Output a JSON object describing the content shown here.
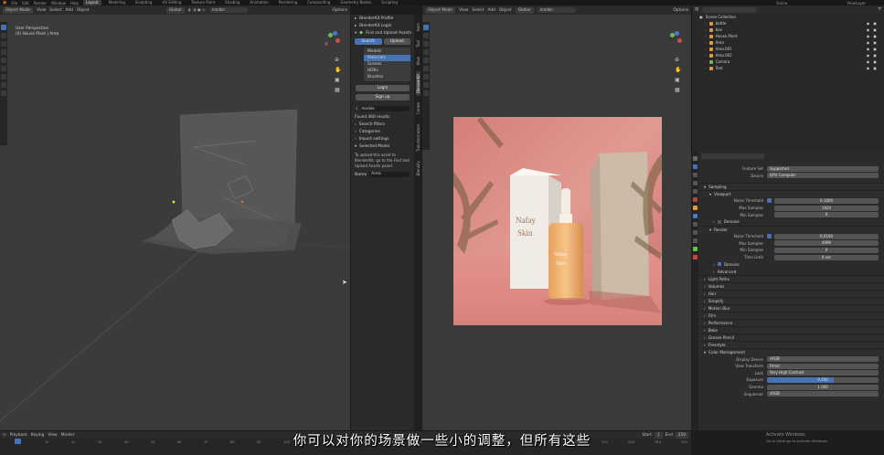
{
  "topbar": {
    "menus": [
      "File",
      "Edit",
      "Render",
      "Window",
      "Help"
    ],
    "workspaces": [
      "Layout",
      "Modeling",
      "Sculpting",
      "UV Editing",
      "Texture Paint",
      "Shading",
      "Animation",
      "Rendering",
      "Compositing",
      "Geometry Nodes",
      "Scripting"
    ],
    "active_workspace": "Layout",
    "scene": "Scene",
    "view_layer": "ViewLayer"
  },
  "viewport_left": {
    "mode": "Object Mode",
    "menus": [
      "View",
      "Select",
      "Add",
      "Object"
    ],
    "transform": "Global",
    "search": "marble",
    "options": "Options",
    "info_line1": "User Perspective",
    "info_line2": "(0) House Plant | Area",
    "subtitle_truncated": "(80"
  },
  "npanel": {
    "items": [
      "BlenderKit Profile",
      "BlenderKit Login",
      "Find and Upload Assets"
    ],
    "search_btn": "Search",
    "upload_btn": "Upload",
    "categories": [
      "Models",
      "Materials",
      "Scenes",
      "HDRs",
      "Brushes"
    ],
    "active_category": "Materials",
    "login_btn": "Login",
    "signup_btn": "Sign up",
    "search_value": "marble",
    "found_text": "Found 460 results",
    "search_filters": "Search filters",
    "categories_label": "Categories",
    "import_settings": "Import settings",
    "selected_model": "Selected Model",
    "upload_text1": "To upload this asset to",
    "upload_text2": "BlenderKit, go to the Find and",
    "upload_text3": "Upload Assets panel.",
    "name_label": "Name",
    "name_value": "Area",
    "vtabs": [
      "Item",
      "Tool",
      "View",
      "BlenderKit",
      "Create",
      "Transformation",
      "Blendify"
    ]
  },
  "viewport_right": {
    "mode": "Object Mode",
    "menus": [
      "View",
      "Select",
      "Add",
      "Object"
    ],
    "transform": "Global",
    "search": "marble",
    "options": "Options",
    "box_text1": "Nafay",
    "box_text2": "Skin",
    "bottle_text1": "Nafay",
    "bottle_text2": "Skin"
  },
  "outliner": {
    "title": "Scene Collection",
    "items": [
      {
        "name": "bottle",
        "color": "#d79a4a"
      },
      {
        "name": "box",
        "color": "#d79a4a"
      },
      {
        "name": "House Plant",
        "color": "#d79a4a"
      },
      {
        "name": "Area",
        "color": "#e0a03a"
      },
      {
        "name": "Area.001",
        "color": "#e0a03a"
      },
      {
        "name": "Area.002",
        "color": "#e0a03a"
      },
      {
        "name": "Camera",
        "color": "#6fb35a"
      },
      {
        "name": "Text",
        "color": "#d79a4a"
      }
    ]
  },
  "properties": {
    "feature_set_label": "Feature Set",
    "feature_set": "Supported",
    "device_label": "Device",
    "device": "GPU Compute",
    "sampling": "Sampling",
    "viewport": "Viewport",
    "noise_threshold_label": "Noise Threshold",
    "noise_threshold_vp": "0.1000",
    "max_samples_label": "Max Samples",
    "max_samples_vp": "1024",
    "min_samples_label": "Min Samples",
    "min_samples_vp": "0",
    "denoise": "Denoise",
    "render": "Render",
    "noise_threshold_r": "0.0100",
    "max_samples_r": "4096",
    "min_samples_r": "0",
    "time_limit_label": "Time Limit",
    "time_limit": "0 sec",
    "advanced": "Advanced",
    "sections": [
      "Light Paths",
      "Volumes",
      "Hair",
      "Simplify",
      "Motion Blur",
      "Film",
      "Performance",
      "Bake",
      "Grease Pencil",
      "Freestyle",
      "Color Management"
    ],
    "display_device_label": "Display Device",
    "display_device": "sRGB",
    "view_transform_label": "View Transform",
    "view_transform": "Filmic",
    "look_label": "Look",
    "look": "Very High Contrast",
    "exposure_label": "Exposure",
    "exposure": "0.200",
    "gamma_label": "Gamma",
    "gamma": "1.000",
    "sequencer_label": "Sequencer",
    "sequencer": "sRGB",
    "activate_windows": "Activate Windows",
    "activate_hint": "Go to Settings to activate Windows."
  },
  "timeline": {
    "menus": [
      "Playback",
      "Keying",
      "View",
      "Marker"
    ],
    "start_label": "Start",
    "start": "1",
    "end_label": "End",
    "end": "250",
    "ticks": [
      "0",
      "10",
      "20",
      "30",
      "40",
      "50",
      "60",
      "70",
      "80",
      "90",
      "100",
      "110",
      "120",
      "130",
      "140",
      "150",
      "160",
      "170",
      "180",
      "190",
      "200",
      "210",
      "220",
      "230",
      "240",
      "250"
    ]
  },
  "caption": "你可以对你的场景做一些小的调整，但所有这些"
}
